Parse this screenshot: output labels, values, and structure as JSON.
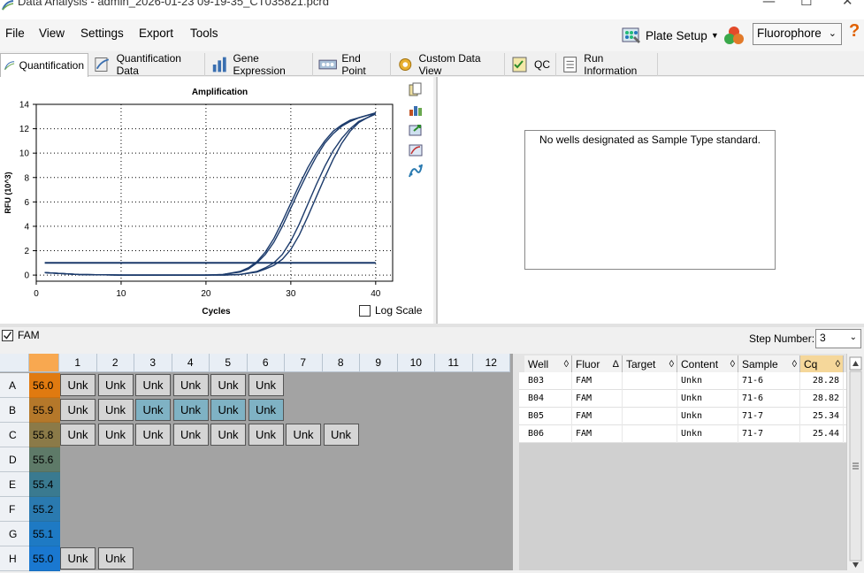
{
  "window": {
    "title": "Data Analysis - admin_2026-01-23 09-19-35_CT035821.pcrd",
    "minimize": "—",
    "maximize": "☐",
    "close": "✕"
  },
  "menu": {
    "items": [
      "File",
      "View",
      "Settings",
      "Export",
      "Tools"
    ],
    "plate_setup": "Plate Setup",
    "fluorophore_value": "Fluorophore",
    "help": "?"
  },
  "tabs": [
    {
      "label": "Quantification",
      "active": true
    },
    {
      "label": "Quantification Data"
    },
    {
      "label": "Gene Expression"
    },
    {
      "label": "End Point"
    },
    {
      "label": "Custom Data View"
    },
    {
      "label": "QC"
    },
    {
      "label": "Run Information"
    }
  ],
  "chart": {
    "log_scale_label": "Log Scale",
    "chart_data": {
      "type": "line",
      "title": "Amplification",
      "xlabel": "Cycles",
      "ylabel": "RFU (10^3)",
      "xlim": [
        0,
        42
      ],
      "ylim": [
        -0.5,
        14
      ],
      "xticks": [
        0,
        10,
        20,
        30,
        40
      ],
      "yticks": [
        0,
        2,
        4,
        6,
        8,
        10,
        12,
        14
      ],
      "grid": true,
      "threshold": 1.0,
      "series": [
        {
          "well": "B05",
          "x": [
            1,
            5,
            10,
            15,
            20,
            22,
            24,
            25,
            26,
            27,
            28,
            29,
            30,
            31,
            32,
            33,
            34,
            35,
            36,
            37,
            38,
            39,
            40
          ],
          "values": [
            0.2,
            0.05,
            0.0,
            0.0,
            0.0,
            0.05,
            0.3,
            0.6,
            1.1,
            1.9,
            3.0,
            4.4,
            5.9,
            7.4,
            8.8,
            10.0,
            11.0,
            11.8,
            12.3,
            12.7,
            12.9,
            13.1,
            13.3
          ]
        },
        {
          "well": "B06",
          "x": [
            1,
            5,
            10,
            15,
            20,
            22,
            24,
            25,
            26,
            27,
            28,
            29,
            30,
            31,
            32,
            33,
            34,
            35,
            36,
            37,
            38,
            39,
            40
          ],
          "values": [
            0.2,
            0.05,
            0.0,
            0.0,
            0.0,
            0.05,
            0.25,
            0.5,
            1.0,
            1.7,
            2.7,
            4.0,
            5.5,
            7.0,
            8.4,
            9.7,
            10.8,
            11.6,
            12.2,
            12.6,
            12.9,
            13.1,
            13.3
          ]
        },
        {
          "well": "B03",
          "x": [
            1,
            5,
            10,
            15,
            20,
            22,
            24,
            26,
            27,
            28,
            29,
            30,
            31,
            32,
            33,
            34,
            35,
            36,
            37,
            38,
            39,
            40
          ],
          "values": [
            0.2,
            0.05,
            0.0,
            0.0,
            0.0,
            0.0,
            0.05,
            0.3,
            0.6,
            1.0,
            1.7,
            2.8,
            4.2,
            5.8,
            7.4,
            8.9,
            10.2,
            11.2,
            12.0,
            12.6,
            12.9,
            13.2
          ]
        },
        {
          "well": "B04",
          "x": [
            1,
            5,
            10,
            15,
            20,
            22,
            24,
            26,
            27,
            28,
            29,
            30,
            31,
            32,
            33,
            34,
            35,
            36,
            37,
            38,
            39,
            40
          ],
          "values": [
            0.2,
            0.05,
            0.0,
            0.0,
            0.0,
            0.0,
            0.05,
            0.25,
            0.5,
            0.8,
            1.3,
            2.1,
            3.3,
            4.8,
            6.4,
            8.0,
            9.5,
            10.8,
            11.8,
            12.5,
            12.9,
            13.3
          ]
        }
      ]
    }
  },
  "standard_panel": {
    "message": "No wells designated as Sample Type standard."
  },
  "filter": {
    "fam_label": "FAM",
    "step_label": "Step Number:",
    "step_value": "3"
  },
  "plate": {
    "columns": [
      "1",
      "2",
      "3",
      "4",
      "5",
      "6",
      "7",
      "8",
      "9",
      "10",
      "11",
      "12"
    ],
    "rows": [
      {
        "label": "A",
        "temp": "56.0",
        "color": "#e07a10",
        "wells": [
          "Unk",
          "Unk",
          "Unk",
          "Unk",
          "Unk",
          "Unk",
          "",
          "",
          "",
          "",
          "",
          ""
        ],
        "selected": []
      },
      {
        "label": "B",
        "temp": "55.9",
        "color": "#b5782a",
        "wells": [
          "Unk",
          "Unk",
          "Unk",
          "Unk",
          "Unk",
          "Unk",
          "",
          "",
          "",
          "",
          "",
          ""
        ],
        "selected": [
          2,
          3,
          4,
          5
        ]
      },
      {
        "label": "C",
        "temp": "55.8",
        "color": "#8b7a48",
        "wells": [
          "Unk",
          "Unk",
          "Unk",
          "Unk",
          "Unk",
          "Unk",
          "Unk",
          "Unk",
          "",
          "",
          "",
          ""
        ],
        "selected": []
      },
      {
        "label": "D",
        "temp": "55.6",
        "color": "#5e7a68",
        "wells": [
          "",
          "",
          "",
          "",
          "",
          "",
          "",
          "",
          "",
          "",
          "",
          ""
        ],
        "selected": []
      },
      {
        "label": "E",
        "temp": "55.4",
        "color": "#3a7a90",
        "wells": [
          "",
          "",
          "",
          "",
          "",
          "",
          "",
          "",
          "",
          "",
          "",
          ""
        ],
        "selected": []
      },
      {
        "label": "F",
        "temp": "55.2",
        "color": "#2a7ab0",
        "wells": [
          "",
          "",
          "",
          "",
          "",
          "",
          "",
          "",
          "",
          "",
          "",
          ""
        ],
        "selected": []
      },
      {
        "label": "G",
        "temp": "55.1",
        "color": "#1e7ac4",
        "wells": [
          "",
          "",
          "",
          "",
          "",
          "",
          "",
          "",
          "",
          "",
          "",
          ""
        ],
        "selected": []
      },
      {
        "label": "H",
        "temp": "55.0",
        "color": "#1a78d0",
        "wells": [
          "Unk",
          "Unk",
          "",
          "",
          "",
          "",
          "",
          "",
          "",
          "",
          "",
          ""
        ],
        "selected": []
      }
    ]
  },
  "table": {
    "headers": [
      {
        "label": "Well",
        "sort": "◊"
      },
      {
        "label": "Fluor",
        "sort": "Δ"
      },
      {
        "label": "Target",
        "sort": "◊"
      },
      {
        "label": "Content",
        "sort": "◊"
      },
      {
        "label": "Sample",
        "sort": "◊"
      },
      {
        "label": "Cq",
        "sort": "◊"
      }
    ],
    "rows": [
      [
        "B03",
        "FAM",
        "",
        "Unkn",
        "71-6",
        "28.28"
      ],
      [
        "B04",
        "FAM",
        "",
        "Unkn",
        "71-6",
        "28.82"
      ],
      [
        "B05",
        "FAM",
        "",
        "Unkn",
        "71-7",
        "25.34"
      ],
      [
        "B06",
        "FAM",
        "",
        "Unkn",
        "71-7",
        "25.44"
      ]
    ]
  },
  "colors": {
    "curve": "#1b3a6b",
    "cq_header": "#f5d79a",
    "selected_well": "#7fb2c4"
  }
}
